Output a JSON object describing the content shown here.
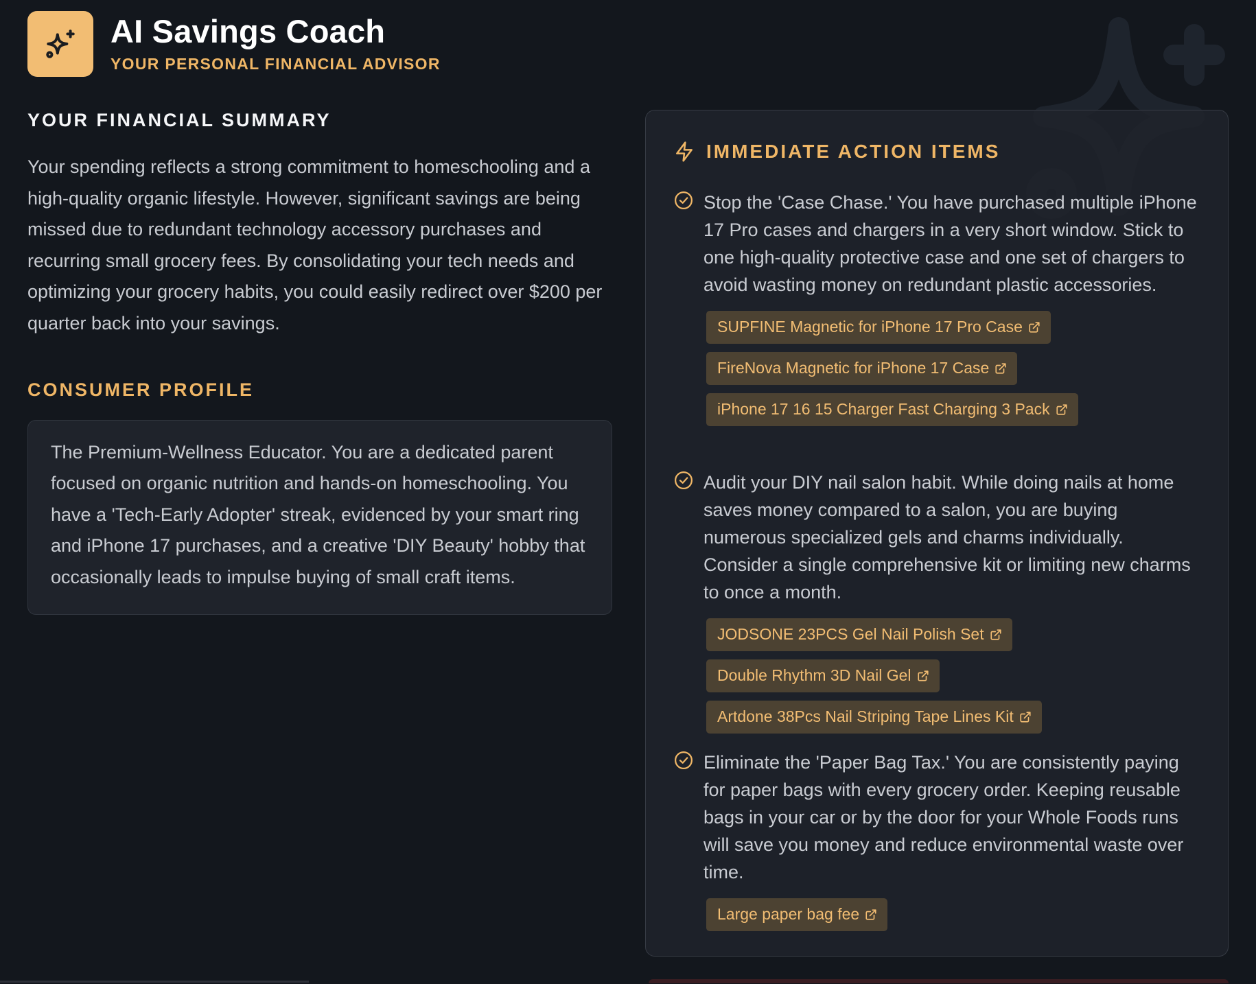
{
  "header": {
    "title": "AI Savings Coach",
    "subtitle": "YOUR PERSONAL FINANCIAL ADVISOR",
    "logo_icon": "sparkles-icon"
  },
  "summary": {
    "heading": "YOUR FINANCIAL SUMMARY",
    "text": "Your spending reflects a strong commitment to homeschooling and a high-quality organic lifestyle. However, significant savings are being missed due to redundant technology accessory purchases and recurring small grocery fees. By consolidating your tech needs and optimizing your grocery habits, you could easily redirect over $200 per quarter back into your savings."
  },
  "profile": {
    "heading": "CONSUMER PROFILE",
    "text": "The Premium-Wellness Educator. You are a dedicated parent focused on organic nutrition and hands-on homeschooling. You have a 'Tech-Early Adopter' streak, evidenced by your smart ring and iPhone 17 purchases, and a creative 'DIY Beauty' hobby that occasionally leads to impulse buying of small craft items."
  },
  "actions": {
    "heading": "IMMEDIATE ACTION ITEMS",
    "heading_icon": "lightning-icon",
    "items": [
      {
        "text": "Stop the 'Case Chase.' You have purchased multiple iPhone 17 Pro cases and chargers in a very short window. Stick to one high-quality protective case and one set of chargers to avoid wasting money on redundant plastic accessories.",
        "links": [
          "SUPFINE Magnetic for iPhone 17 Pro Case",
          "FireNova Magnetic for iPhone 17 Case",
          "iPhone 17 16 15 Charger Fast Charging 3 Pack"
        ]
      },
      {
        "text": "Audit your DIY nail salon habit. While doing nails at home saves money compared to a salon, you are buying numerous specialized gels and charms individually. Consider a single comprehensive kit or limiting new charms to once a month.",
        "links": [
          "JODSONE 23PCS Gel Nail Polish Set",
          "Double Rhythm 3D Nail Gel",
          "Artdone 38Pcs Nail Striping Tape Lines Kit"
        ]
      },
      {
        "text": "Eliminate the 'Paper Bag Tax.' You are consistently paying for paper bags with every grocery order. Keeping reusable bags in your car or by the door for your Whole Foods runs will save you money and reduce environmental waste over time.",
        "links": [
          "Large paper bag fee"
        ]
      }
    ]
  },
  "colors": {
    "background": "#13171d",
    "accent": "#efb666",
    "card": "#1f232b",
    "chip_bg": "#4c4232",
    "chip_text": "#f2bd73"
  }
}
